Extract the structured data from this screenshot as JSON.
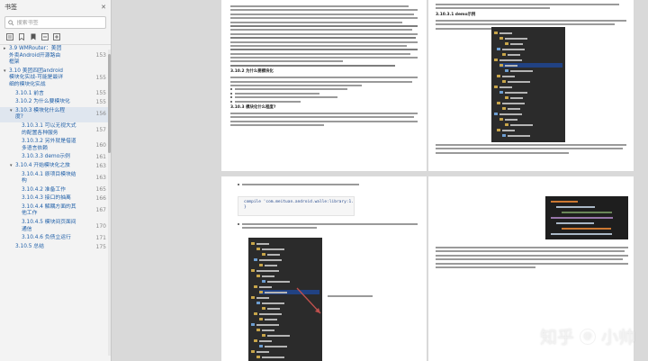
{
  "sidebar": {
    "title": "书签",
    "search_placeholder": "搜索书签",
    "tools": [
      "outline-view-icon",
      "bookmark-add-icon",
      "bookmark-icon",
      "bookmark-remove-icon",
      "expand-icon"
    ],
    "items": [
      {
        "label": "3.9 WMRouter：美团外卖Android开源路由框架",
        "page": "153",
        "indent": 1,
        "twisty": "▸"
      },
      {
        "label": "3.10 美团四团android模块化实战-可能是最详细的模块化实战",
        "page": "155",
        "indent": 1,
        "twisty": "▾"
      },
      {
        "label": "3.10.1 前言",
        "page": "155",
        "indent": 2,
        "twisty": ""
      },
      {
        "label": "3.10.2 为什么要模块化",
        "page": "155",
        "indent": 2,
        "twisty": ""
      },
      {
        "label": "3.10.3 模块化什么程度?",
        "page": "156",
        "indent": 2,
        "twisty": "▾"
      },
      {
        "label": "3.10.3.1 可以无视大式的配置各种服务",
        "page": "157",
        "indent": 3,
        "twisty": ""
      },
      {
        "label": "3.10.3.2 另外就是借道多语言依赖",
        "page": "160",
        "indent": 3,
        "twisty": ""
      },
      {
        "label": "3.10.3.3 demo示例",
        "page": "161",
        "indent": 3,
        "twisty": ""
      },
      {
        "label": "3.10.4 开始模块化之旅",
        "page": "163",
        "indent": 2,
        "twisty": "▾"
      },
      {
        "label": "3.10.4.1 原项目模块结构",
        "page": "163",
        "indent": 3,
        "twisty": ""
      },
      {
        "label": "3.10.4.2 准备工作",
        "page": "165",
        "indent": 3,
        "twisty": ""
      },
      {
        "label": "3.10.4.3 接口的抽离",
        "page": "166",
        "indent": 3,
        "twisty": ""
      },
      {
        "label": "3.10.4.4 解耦方面的其他工作",
        "page": "167",
        "indent": 3,
        "twisty": ""
      },
      {
        "label": "3.10.4.5 模块间页面间通信",
        "page": "170",
        "indent": 3,
        "twisty": ""
      },
      {
        "label": "3.10.4.6 负债立运行",
        "page": "171",
        "indent": 3,
        "twisty": ""
      },
      {
        "label": "3.10.5 总结",
        "page": "175",
        "indent": 2,
        "twisty": ""
      }
    ],
    "selected_index": 4
  },
  "document": {
    "heading_1": "3.10.2 为什么要模块化",
    "heading_2": "3.10.3 模块化什么程度?",
    "heading_3": "3.10.3.1 demo示例",
    "code_line_1": "compile 'com.meituan.android.walle:library:1.1.3'",
    "code_line_2": "}",
    "watermark_left": "知乎",
    "watermark_right": "小帅",
    "watermark_at": "@"
  },
  "colors": {
    "toc_link": "#1f5fa8",
    "selected": "#dfe6ef",
    "highlight_red": "#c0504d",
    "ide_bg": "#2b2b2b"
  }
}
